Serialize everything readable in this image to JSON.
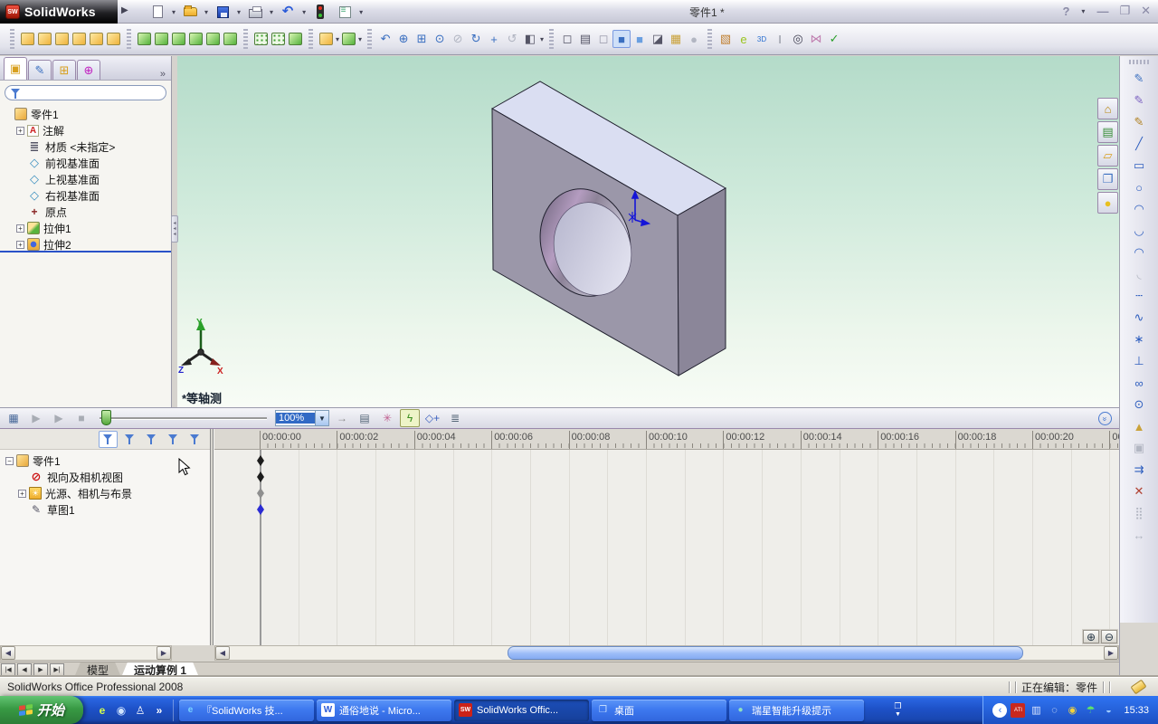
{
  "window": {
    "logo_text": "SolidWorks",
    "title": "零件1 *",
    "help_label": "?"
  },
  "toolbars": {
    "standard": [
      {
        "name": "new-document-button",
        "icon": "page",
        "arrow": true
      },
      {
        "name": "open-button",
        "icon": "folder",
        "arrow": true
      },
      {
        "name": "save-button",
        "icon": "floppy",
        "arrow": true
      },
      {
        "name": "print-button",
        "icon": "printer",
        "arrow": true
      },
      {
        "name": "undo-button",
        "icon": "undo",
        "arrow": true
      },
      {
        "name": "rebuild-traffic-light-button",
        "icon": "traffic",
        "arrow": false
      },
      {
        "name": "options-button",
        "icon": "opts",
        "arrow": true
      }
    ],
    "features": [
      {
        "name": "extruded-boss-button",
        "cls": "gold"
      },
      {
        "name": "revolved-boss-button",
        "cls": "gold"
      },
      {
        "name": "swept-boss-button",
        "cls": "gold"
      },
      {
        "name": "lofted-boss-button",
        "cls": "gold"
      },
      {
        "name": "extruded-cut-button",
        "cls": "gold"
      },
      {
        "name": "revolved-cut-button",
        "cls": "gold"
      },
      {
        "grip": true
      },
      {
        "name": "swept-cut-button",
        "cls": "green"
      },
      {
        "name": "lofted-cut-button",
        "cls": "green"
      },
      {
        "name": "fillet-button",
        "cls": "green"
      },
      {
        "name": "chamfer-button",
        "cls": "green"
      },
      {
        "name": "rib-button",
        "cls": "green"
      },
      {
        "name": "hole-wizard-button",
        "cls": "green"
      },
      {
        "grip": true
      },
      {
        "name": "linear-pattern-button",
        "cls": "pat"
      },
      {
        "name": "circular-pattern-button",
        "cls": "pat"
      },
      {
        "name": "mirror-button",
        "cls": "green"
      },
      {
        "grip": true
      },
      {
        "name": "reference-geometry-button",
        "cls": "gold",
        "arrow": true
      },
      {
        "name": "curves-button",
        "cls": "green",
        "arrow": true
      }
    ],
    "view": [
      {
        "name": "view-previous-button",
        "g": "↶",
        "c": "#3a6fc0"
      },
      {
        "name": "zoom-to-fit-button",
        "g": "⊕",
        "c": "#3a6fc0"
      },
      {
        "name": "zoom-to-area-button",
        "g": "⊞",
        "c": "#3a6fc0"
      },
      {
        "name": "zoom-in-out-button",
        "g": "⊙",
        "c": "#3a6fc0"
      },
      {
        "name": "zoom-to-selection-button",
        "g": "⊘",
        "cls": "dis"
      },
      {
        "name": "rotate-view-button",
        "g": "↻",
        "c": "#3a6fc0"
      },
      {
        "name": "pan-button",
        "g": "+",
        "c": "#3a6fc0"
      },
      {
        "name": "roll-view-button",
        "g": "↺",
        "cls": "dis"
      },
      {
        "name": "section-view-button",
        "g": "◧",
        "c": "#556",
        "arrow": true
      },
      {
        "grip": true
      },
      {
        "name": "wireframe-button",
        "g": "◻",
        "c": "#556"
      },
      {
        "name": "hidden-lines-visible-button",
        "g": "▤",
        "c": "#556"
      },
      {
        "name": "hidden-lines-removed-button",
        "g": "◻",
        "c": "#99a"
      },
      {
        "name": "shaded-with-edges-button",
        "g": "■",
        "c": "#3a6fc0",
        "cls": "on"
      },
      {
        "name": "shaded-button",
        "g": "■",
        "c": "#6a9fe0"
      },
      {
        "name": "shadows-in-shaded-button",
        "g": "◪",
        "c": "#556"
      },
      {
        "name": "realview-button",
        "g": "▦",
        "c": "#caa23a"
      },
      {
        "name": "apply-scene-button",
        "g": "●",
        "cls": "dis"
      }
    ],
    "office": [
      {
        "name": "photoworks-render-button",
        "g": "▧",
        "c": "#c07f2f"
      },
      {
        "name": "publish-edrawings-button",
        "g": "e",
        "c": "#9ac41e"
      },
      {
        "name": "3d-content-central-button",
        "g": "3D",
        "c": "#2a6fd0",
        "fs": 8
      },
      {
        "name": "toolbox-button",
        "g": "I",
        "c": "#8a8f9a"
      },
      {
        "name": "design-checker-button",
        "g": "◎",
        "c": "#445"
      },
      {
        "name": "featureworks-button",
        "g": "⋈",
        "c": "#c07fb0"
      },
      {
        "name": "verification-button",
        "g": "✓",
        "c": "#2a9f2a"
      }
    ],
    "sketch_column": [
      {
        "name": "sketch-button",
        "g": "✎",
        "c": "#3a6fc0"
      },
      {
        "name": "3d-sketch-button",
        "g": "✎",
        "c": "#7a5fc0"
      },
      {
        "name": "modify-sketch-button",
        "g": "✎",
        "c": "#b08020"
      },
      {
        "name": "line-button",
        "g": "╱",
        "c": "#2f5fbf"
      },
      {
        "name": "rectangle-button",
        "g": "▭",
        "c": "#2f5fbf"
      },
      {
        "name": "circle-button",
        "g": "○",
        "c": "#2f5fbf"
      },
      {
        "name": "centerpoint-arc-button",
        "g": "◠",
        "c": "#2f5fbf"
      },
      {
        "name": "tangent-arc-button",
        "g": "◡",
        "c": "#2f5fbf"
      },
      {
        "name": "three-point-arc-button",
        "g": "◠",
        "c": "#2f5fbf"
      },
      {
        "name": "sketch-fillet-button",
        "g": "◟",
        "cls": "dis"
      },
      {
        "name": "centerline-button",
        "g": "┄",
        "c": "#2f5fbf"
      },
      {
        "name": "spline-button",
        "g": "∿",
        "c": "#2f5fbf"
      },
      {
        "name": "point-button",
        "g": "∗",
        "c": "#2f5fbf"
      },
      {
        "name": "add-relation-button",
        "g": "⊥",
        "c": "#2f5fbf"
      },
      {
        "name": "display-relations-button",
        "g": "∞",
        "c": "#2f5fbf"
      },
      {
        "name": "mirror-entities-button",
        "g": "⊙",
        "c": "#2f5fbf"
      },
      {
        "name": "sketch-text-button",
        "g": "▲",
        "c": "#caa23a"
      },
      {
        "name": "convert-entities-button",
        "g": "▣",
        "cls": "dis"
      },
      {
        "name": "offset-entities-button",
        "g": "⇉",
        "c": "#2f5fbf"
      },
      {
        "name": "trim-entities-button",
        "g": "✕",
        "c": "#b04030"
      },
      {
        "name": "linear-sketch-pattern-button",
        "g": "⣿",
        "cls": "dis"
      },
      {
        "name": "move-entities-button",
        "g": "↔",
        "cls": "dis"
      }
    ],
    "task_pane": [
      {
        "name": "solidworks-resources-tab",
        "g": "⌂",
        "c": "#b8860b"
      },
      {
        "name": "design-library-tab",
        "g": "▤",
        "c": "#3a8f3a"
      },
      {
        "name": "file-explorer-tab",
        "g": "▱",
        "c": "#d8a020"
      },
      {
        "name": "view-palette-tab",
        "g": "❐",
        "c": "#3a6fc0"
      },
      {
        "name": "appearances-scenes-tab",
        "g": "●",
        "c": "#e8c020"
      }
    ],
    "fm_tabs": [
      {
        "name": "featuremanager-tab",
        "g": "▣",
        "c": "#d8a020",
        "active": true
      },
      {
        "name": "propertymanager-tab",
        "g": "✎",
        "c": "#3a6fc0"
      },
      {
        "name": "configurationmanager-tab",
        "g": "⊞",
        "c": "#d8a020"
      },
      {
        "name": "dimxpert-tab",
        "g": "⊕",
        "c": "#c020c0"
      }
    ]
  },
  "feature_manager": {
    "more_label": "»",
    "tree": [
      {
        "name": "tree-item-part-root",
        "label": "零件1",
        "icon": "part",
        "indent": 0,
        "expand": ""
      },
      {
        "name": "tree-item-annotations",
        "label": "注解",
        "icon": "ann",
        "indent": 1,
        "expand": "+"
      },
      {
        "name": "tree-item-material",
        "label": "材质 <未指定>",
        "icon": "mat",
        "indent": 1,
        "expand": ""
      },
      {
        "name": "tree-item-front-plane",
        "label": "前视基准面",
        "icon": "plane",
        "indent": 1,
        "expand": ""
      },
      {
        "name": "tree-item-top-plane",
        "label": "上视基准面",
        "icon": "plane",
        "indent": 1,
        "expand": ""
      },
      {
        "name": "tree-item-right-plane",
        "label": "右视基准面",
        "icon": "plane",
        "indent": 1,
        "expand": ""
      },
      {
        "name": "tree-item-origin",
        "label": "原点",
        "icon": "origin",
        "indent": 1,
        "expand": ""
      },
      {
        "name": "tree-item-extrude1",
        "label": "拉伸1",
        "icon": "ext1",
        "indent": 1,
        "expand": "+"
      },
      {
        "name": "tree-item-extrude2",
        "label": "拉伸2",
        "icon": "ext2",
        "indent": 1,
        "expand": "+"
      }
    ]
  },
  "viewport": {
    "view_label": "*等轴测",
    "triad": {
      "x": "X",
      "y": "Y",
      "z": "Z"
    }
  },
  "motion": {
    "toolbar": {
      "zoom_value": "100%",
      "left_buttons": [
        {
          "name": "calculate-button",
          "g": "▦",
          "c": "#4a6a9a"
        },
        {
          "name": "play-from-start-button",
          "g": "▶",
          "c": "#a8acb4"
        },
        {
          "name": "play-button",
          "g": "▶",
          "c": "#a8acb4"
        },
        {
          "name": "stop-button",
          "g": "■",
          "c": "#a8acb4"
        }
      ],
      "right_buttons": [
        {
          "name": "playback-mode-button",
          "g": "→",
          "c": "#888"
        },
        {
          "name": "save-animation-button",
          "g": "▤",
          "c": "#567"
        },
        {
          "name": "animation-wizard-button",
          "g": "✳",
          "c": "#c06090"
        },
        {
          "name": "autokey-button",
          "g": "ϟ",
          "c": "#3a8f1f",
          "pressed": true
        },
        {
          "name": "add-key-button",
          "g": "◇+",
          "c": "#3a5fbf"
        },
        {
          "name": "motion-properties-button",
          "g": "≣",
          "c": "#567"
        }
      ]
    },
    "filters": [
      {
        "name": "filter-all-button",
        "active": true
      },
      {
        "name": "filter-animated-button"
      },
      {
        "name": "filter-driving-button"
      },
      {
        "name": "filter-selected-button"
      },
      {
        "name": "filter-results-button",
        "disabled": true
      }
    ],
    "tree": [
      {
        "name": "motion-item-part-root",
        "label": "零件1",
        "icon": "part",
        "indent": 0,
        "expand": "−"
      },
      {
        "name": "motion-item-orientation-camera-views",
        "label": "视向及相机视图",
        "icon": "noview",
        "indent": 1,
        "expand": ""
      },
      {
        "name": "motion-item-lights-cameras-scene",
        "label": "光源、相机与布景",
        "icon": "lights",
        "indent": 1,
        "expand": "+"
      },
      {
        "name": "motion-item-sketch1",
        "label": "草图1",
        "icon": "sketch",
        "indent": 1,
        "expand": ""
      }
    ],
    "timeline": {
      "labels": [
        "00:00:00",
        "00:00:02",
        "00:00:04",
        "00:00:06",
        "00:00:08",
        "00:00:10",
        "00:00:12",
        "00:00:14",
        "00:00:16",
        "00:00:18",
        "00:00:20",
        "00"
      ],
      "keys": [
        {
          "row": 0,
          "color": "#1c1c1c"
        },
        {
          "row": 1,
          "color": "#1c1c1c"
        },
        {
          "row": 2,
          "color": "#8f8f8f"
        },
        {
          "row": 3,
          "color": "#2b2bd4"
        }
      ]
    }
  },
  "sheet_tabs": {
    "nav": [
      "|◀",
      "◀",
      "▶",
      "▶|"
    ],
    "model": "模型",
    "motion": "运动算例 1"
  },
  "status_bar": {
    "left": "SolidWorks Office Professional 2008",
    "editing": "正在编辑：零件"
  },
  "taskbar": {
    "start_label": "开始",
    "clock": "15:33",
    "quick_launch": [
      {
        "name": "edrawings-quicklaunch-icon",
        "g": "e",
        "c": "#d6ff4a"
      },
      {
        "name": "capture-quicklaunch-icon",
        "g": "◉",
        "c": "#cfe4ff"
      },
      {
        "name": "qq-quicklaunch-icon",
        "g": "♙",
        "c": "#ffffff"
      },
      {
        "name": "quicklaunch-more-icon",
        "g": "»",
        "c": "#ffffff"
      }
    ],
    "tasks": [
      {
        "name": "task-ie-solidworks",
        "label": "『SolidWorks 技...",
        "icon": "e",
        "ic_c": "#7ad4ff",
        "ic_bg": ""
      },
      {
        "name": "task-word-document",
        "label": "通俗地说 - Micro...",
        "icon": "W",
        "ic_c": "#2a5ad8",
        "ic_bg": "#ffffff"
      },
      {
        "name": "task-solidworks",
        "label": "SolidWorks Offic...",
        "icon": "SW",
        "ic_c": "#ffffff",
        "ic_bg": "#cc2218",
        "active": true
      },
      {
        "name": "task-desktop",
        "label": "桌面",
        "icon": "❐",
        "ic_c": "#cfe4ff",
        "ic_bg": ""
      },
      {
        "name": "task-rising-prompt",
        "label": "瑞星智能升级提示",
        "icon": "●",
        "ic_c": "#8fe0c0",
        "ic_bg": ""
      }
    ],
    "tray": [
      {
        "name": "tray-collapse-icon",
        "g": "‹",
        "c": "#2a6ff0",
        "bg": "#ffffff",
        "round": true
      },
      {
        "name": "ati-tray-icon",
        "g": "ATI",
        "c": "#ffffff",
        "bg": "#c8281e",
        "fs": 6
      },
      {
        "name": "display-tray-icon",
        "g": "▥",
        "c": "#dfe8ff"
      },
      {
        "name": "magnifier-tray-icon",
        "g": "◌",
        "c": "#ffffff"
      },
      {
        "name": "cd-tray-icon",
        "g": "◉",
        "c": "#f4d23a"
      },
      {
        "name": "antivirus-umbrella-tray-icon",
        "g": "☂",
        "c": "#5ee26a"
      },
      {
        "name": "network-tray-icon",
        "g": "◒",
        "c": "#9ecbff"
      }
    ]
  }
}
